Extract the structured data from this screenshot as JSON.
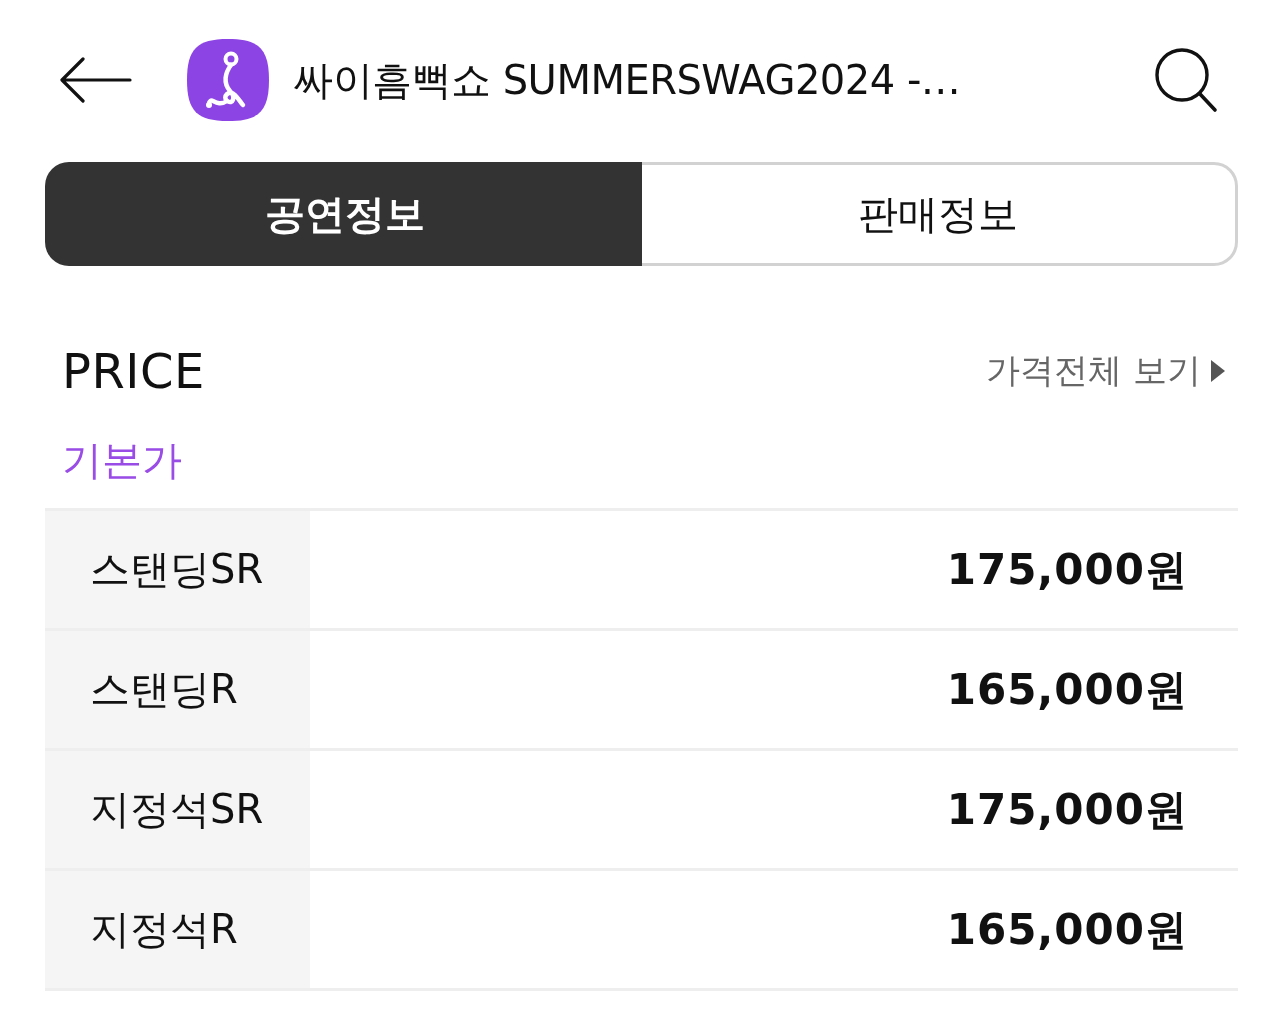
{
  "header": {
    "title": "싸이흠뻑쇼 SUMMERSWAG2024 -…"
  },
  "tabs": [
    {
      "label": "공연정보",
      "selected": true
    },
    {
      "label": "판매정보",
      "selected": false
    }
  ],
  "price_section": {
    "heading": "PRICE",
    "view_all_link": "가격전체 보기",
    "category": "기본가",
    "rows": [
      {
        "seat": "스탠딩SR",
        "price": "175,000원"
      },
      {
        "seat": "스탠딩R",
        "price": "165,000원"
      },
      {
        "seat": "지정석SR",
        "price": "175,000원"
      },
      {
        "seat": "지정석R",
        "price": "165,000원"
      }
    ]
  }
}
